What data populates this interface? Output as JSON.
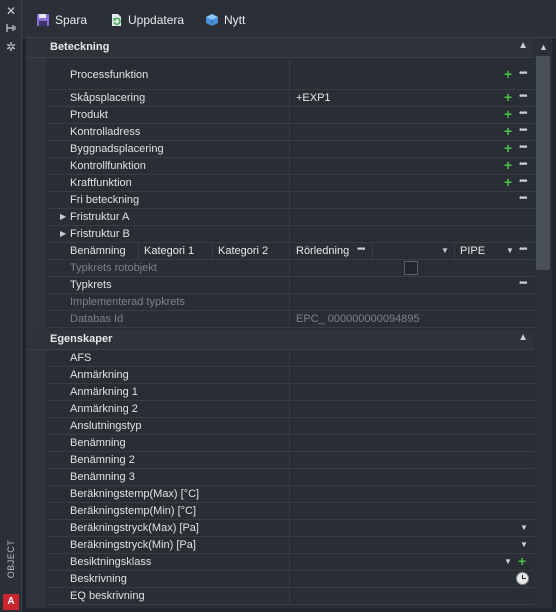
{
  "left_strip": {
    "close_icon": "close-icon",
    "label": "OBJECT",
    "brand_glyph": "A"
  },
  "toolbar": {
    "save_label": "Spara",
    "update_label": "Uppdatera",
    "new_label": "Nytt"
  },
  "sections": {
    "beteckning": {
      "title": "Beteckning",
      "rows": {
        "processfunktion": "Processfunktion",
        "skapsplacering": "Skåpsplacering",
        "skapsplacering_value": "+EXP1",
        "produkt": "Produkt",
        "kontrolladress": "Kontrolladress",
        "byggnadsplacering": "Byggnadsplacering",
        "kontrollfunktion": "Kontrollfunktion",
        "kraftfunktion": "Kraftfunktion",
        "fri_beteckning": "Fri beteckning",
        "fristruktur_a": "Fristruktur A",
        "fristruktur_b": "Fristruktur B",
        "benamning": "Benämning",
        "kategori1": "Kategori 1",
        "kategori2": "Kategori 2",
        "rorledning": "Rörledning",
        "pipe": "PIPE",
        "typkrets_rotobjekt": "Typkrets rotobjekt",
        "typkrets": "Typkrets",
        "implementerad_typkrets": "Implementerad typkrets",
        "databas_id": "Databas Id",
        "databas_id_value": "EPC_ 000000000094895"
      }
    },
    "egenskaper": {
      "title": "Egenskaper",
      "rows": [
        "AFS",
        "Anmärkning",
        "Anmärkning 1",
        "Anmärkning 2",
        "Anslutningstyp",
        "Benämning",
        "Benämning 2",
        "Benämning 3",
        "Beräkningstemp(Max) [°C]",
        "Beräkningstemp(Min) [°C]",
        "Beräkningstryck(Max) [Pa]",
        "Beräkningstryck(Min) [Pa]",
        "Besiktningsklass",
        "Beskrivning",
        "EQ beskrivning"
      ]
    }
  },
  "colors": {
    "accent_green": "#4cc04c",
    "brand_red": "#c8262c",
    "background": "#2a2e34"
  }
}
